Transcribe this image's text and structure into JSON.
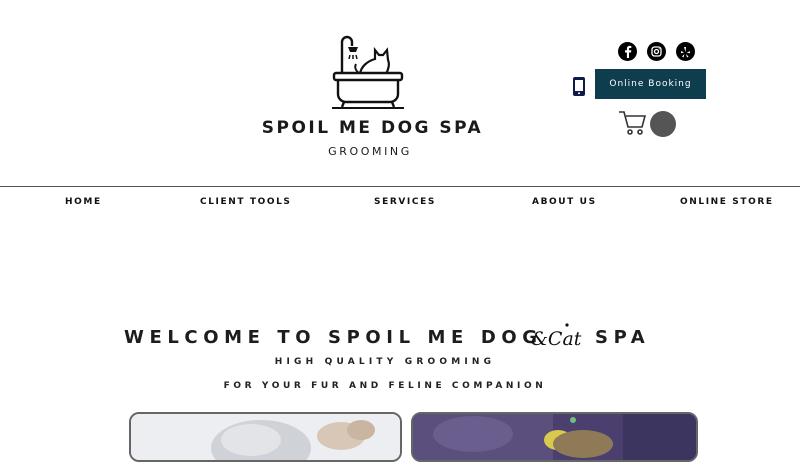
{
  "header": {
    "brand_name": "SPOIL ME DOG SPA",
    "brand_sub": "GROOMING",
    "logo_icon": "bathtub-cat-icon"
  },
  "social": [
    {
      "name": "facebook-icon",
      "glyph": "f"
    },
    {
      "name": "instagram-icon",
      "glyph": ""
    },
    {
      "name": "yelp-icon",
      "glyph": ""
    }
  ],
  "actions": {
    "booking_label": "Online Booking",
    "phone_icon": "phone-icon",
    "cart_icon": "cart-icon"
  },
  "nav": {
    "items": [
      {
        "label": "HOME"
      },
      {
        "label": "CLIENT TOOLS"
      },
      {
        "label": "SERVICES"
      },
      {
        "label": "ABOUT US"
      },
      {
        "label": "ONLINE STORE"
      }
    ]
  },
  "hero": {
    "welcome_left": "WELCOME TO SPOIL ME DOG",
    "welcome_script": "&Cat",
    "welcome_right": "SPA",
    "tagline_1": "HIGH QUALITY GROOMING",
    "tagline_2": "FOR YOUR FUR AND FELINE COMPANION"
  },
  "colors": {
    "booking_bg": "#0e3e4d",
    "text": "#1a1a1a"
  }
}
